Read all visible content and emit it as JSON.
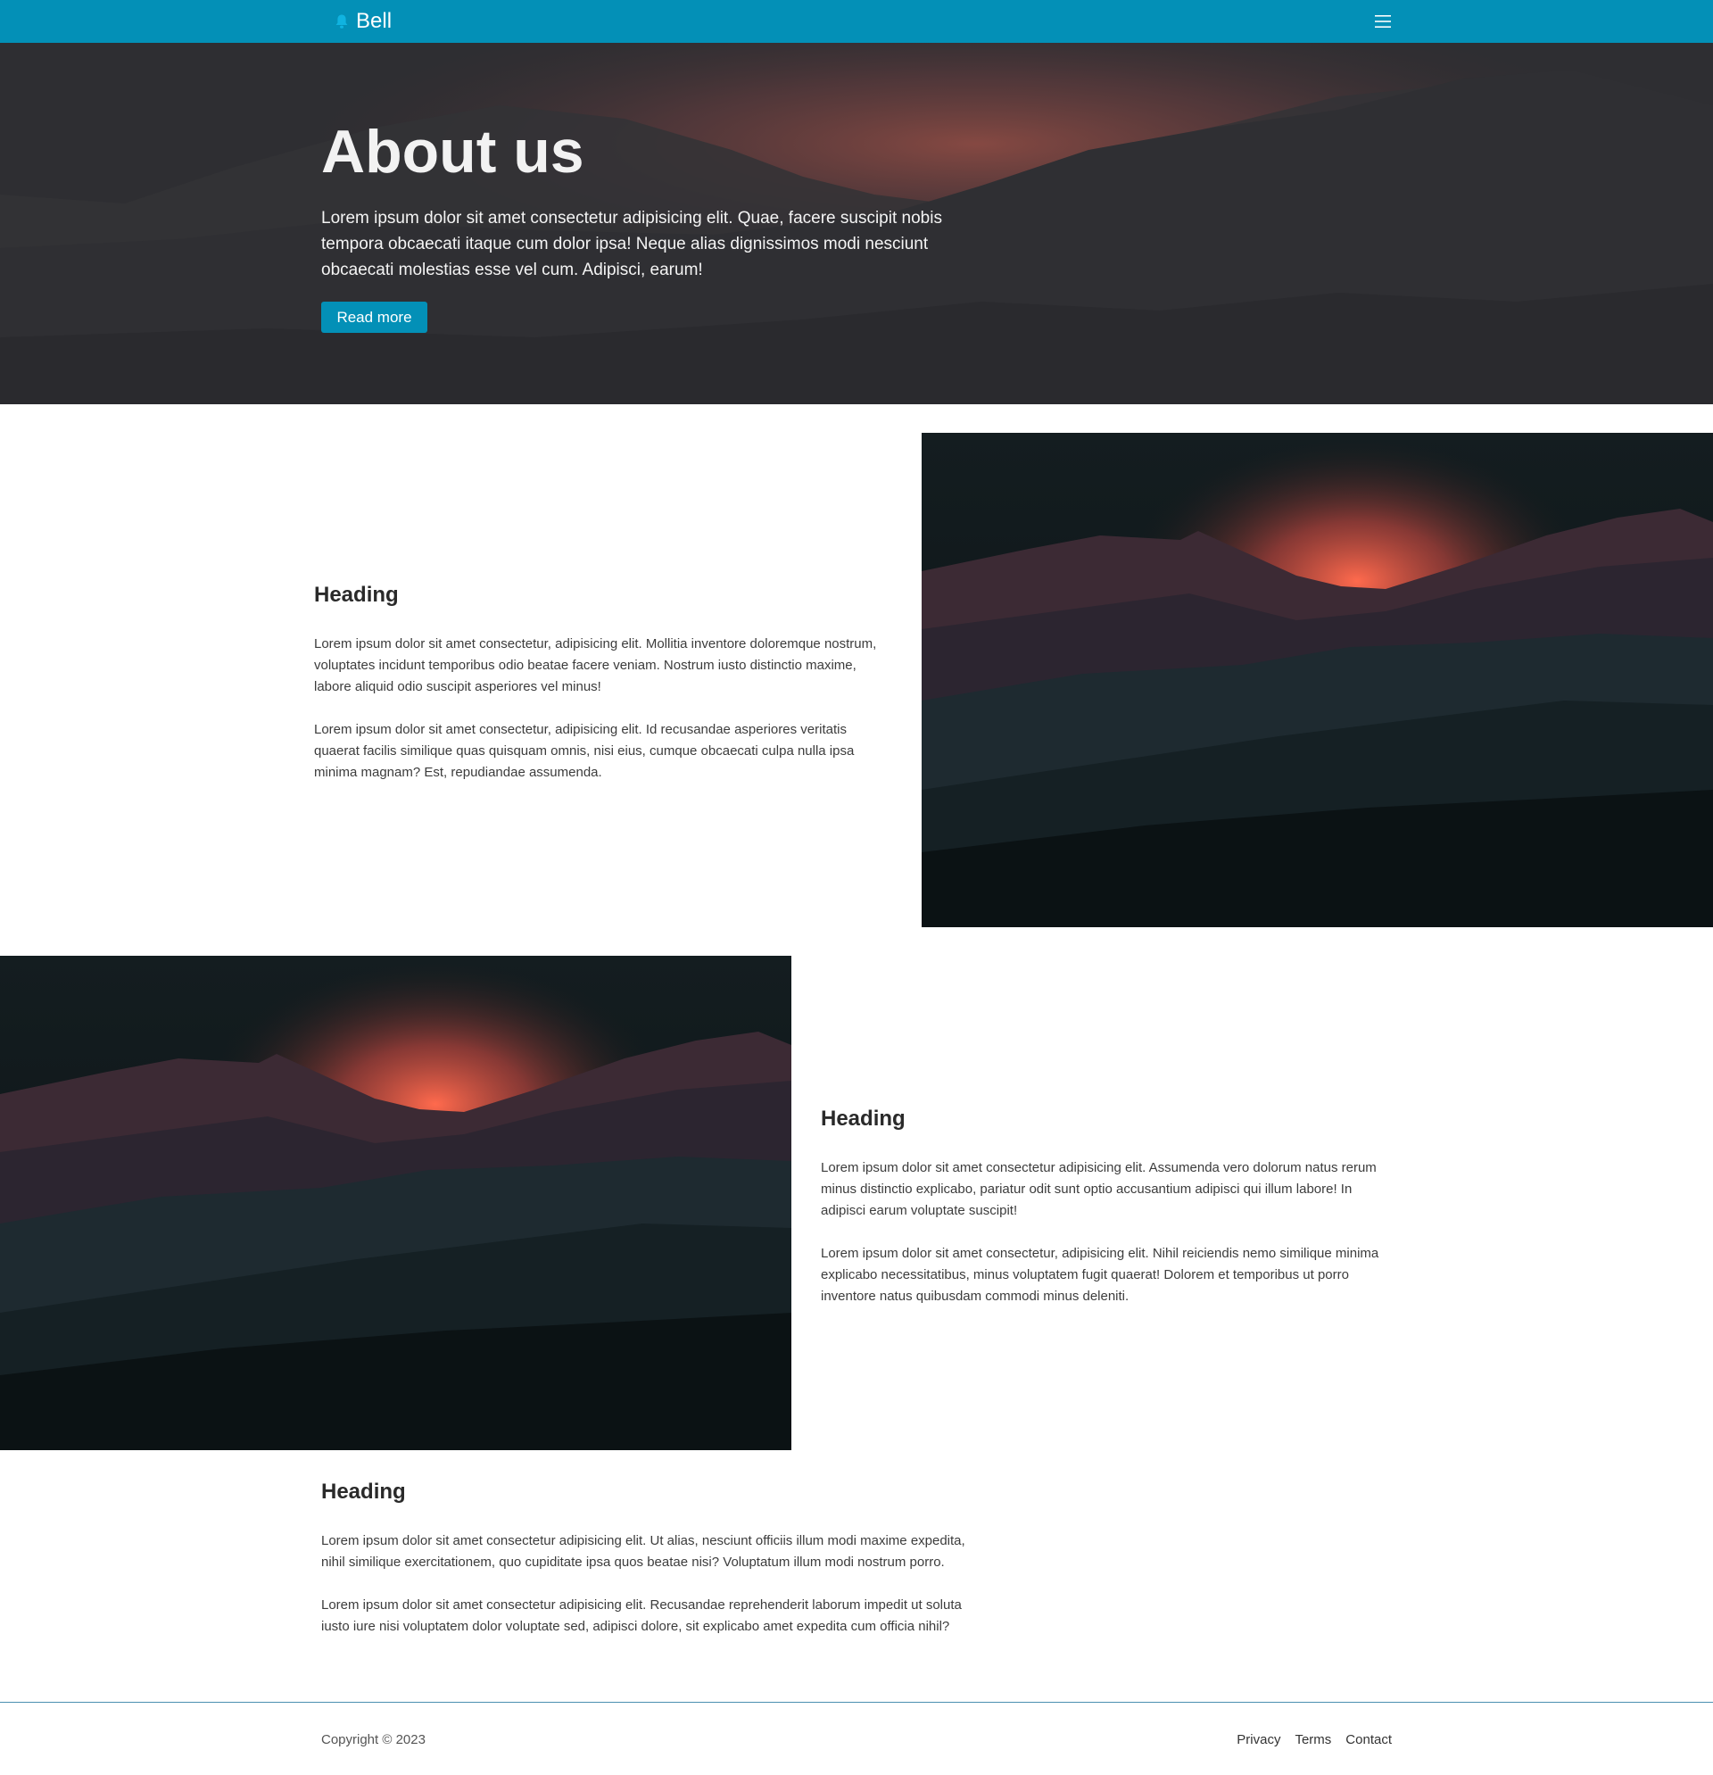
{
  "brand": {
    "name": "Bell",
    "icon": "bell-icon",
    "accent_color": "#0390b7"
  },
  "nav": {
    "menu_icon": "hamburger-menu-icon"
  },
  "hero": {
    "title": "About us",
    "text": "Lorem ipsum dolor sit amet consectetur adipisicing elit. Quae, facere suscipit nobis tempora obcaecati itaque cum dolor ipsa! Neque alias dignissimos modi nesciunt obcaecati molestias esse vel cum. Adipisci, earum!",
    "button_label": "Read more"
  },
  "sections": [
    {
      "heading": "Heading",
      "paragraphs": [
        "Lorem ipsum dolor sit amet consectetur, adipisicing elit. Mollitia inventore doloremque nostrum, voluptates incidunt temporibus odio beatae facere veniam. Nostrum iusto distinctio maxime, labore aliquid odio suscipit asperiores vel minus!",
        "Lorem ipsum dolor sit amet consectetur, adipisicing elit. Id recusandae asperiores veritatis quaerat facilis similique quas quisquam omnis, nisi eius, cumque obcaecati culpa nulla ipsa minima magnam? Est, repudiandae assumenda."
      ]
    },
    {
      "heading": "Heading",
      "paragraphs": [
        "Lorem ipsum dolor sit amet consectetur adipisicing elit. Assumenda vero dolorum natus rerum minus distinctio explicabo, pariatur odit sunt optio accusantium adipisci qui illum labore! In adipisci earum voluptate suscipit!",
        "Lorem ipsum dolor sit amet consectetur, adipisicing elit. Nihil reiciendis nemo similique minima explicabo necessitatibus, minus voluptatem fugit quaerat! Dolorem et temporibus ut porro inventore natus quibusdam commodi minus deleniti."
      ]
    },
    {
      "heading": "Heading",
      "paragraphs": [
        "Lorem ipsum dolor sit amet consectetur adipisicing elit. Ut alias, nesciunt officiis illum modi maxime expedita, nihil similique exercitationem, quo cupiditate ipsa quos beatae nisi? Voluptatum illum modi nostrum porro.",
        "Lorem ipsum dolor sit amet consectetur adipisicing elit. Recusandae reprehenderit laborum impedit ut soluta iusto iure nisi voluptatem dolor voluptate sed, adipisci dolore, sit explicabo amet expedita cum officia nihil?"
      ]
    }
  ],
  "footer": {
    "copyright": "Copyright © 2023",
    "links": [
      "Privacy",
      "Terms",
      "Contact"
    ]
  }
}
